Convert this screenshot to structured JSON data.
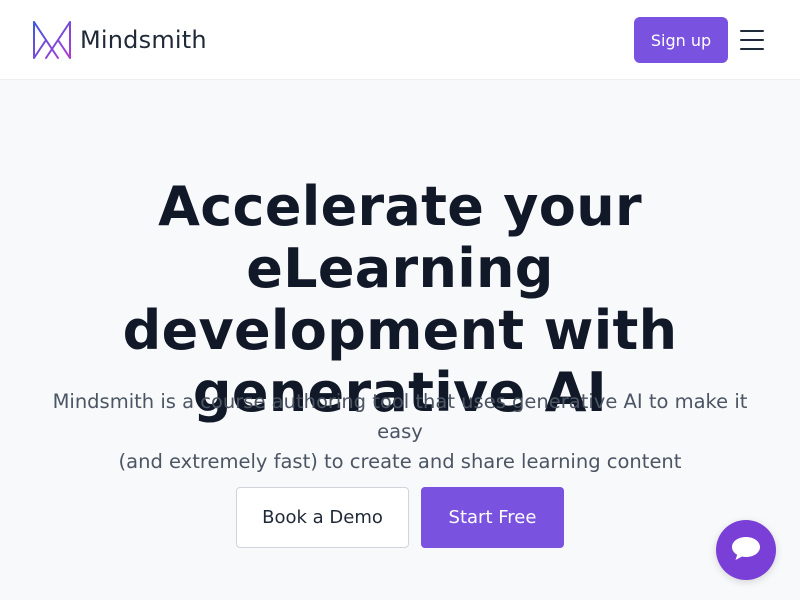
{
  "header": {
    "brand": "Mindsmith",
    "signup_label": "Sign up",
    "logo_icon": "mindsmith-logo-icon",
    "menu_icon": "hamburger-menu-icon"
  },
  "hero": {
    "title_lines": [
      "Accelerate your eLearning",
      "development with",
      "generative AI"
    ],
    "subtitle_lines": [
      "Mindsmith is a course authoring tool that uses generative AI to make it easy",
      "(and extremely fast) to create and share learning content"
    ],
    "demo_label": "Book a Demo",
    "start_label": "Start Free"
  },
  "chat": {
    "icon": "chat-bubble-icon"
  },
  "colors": {
    "accent": "#7a52e0",
    "chat": "#7a3fd6",
    "background": "#f8f9fb",
    "header_bg": "#ffffff"
  }
}
